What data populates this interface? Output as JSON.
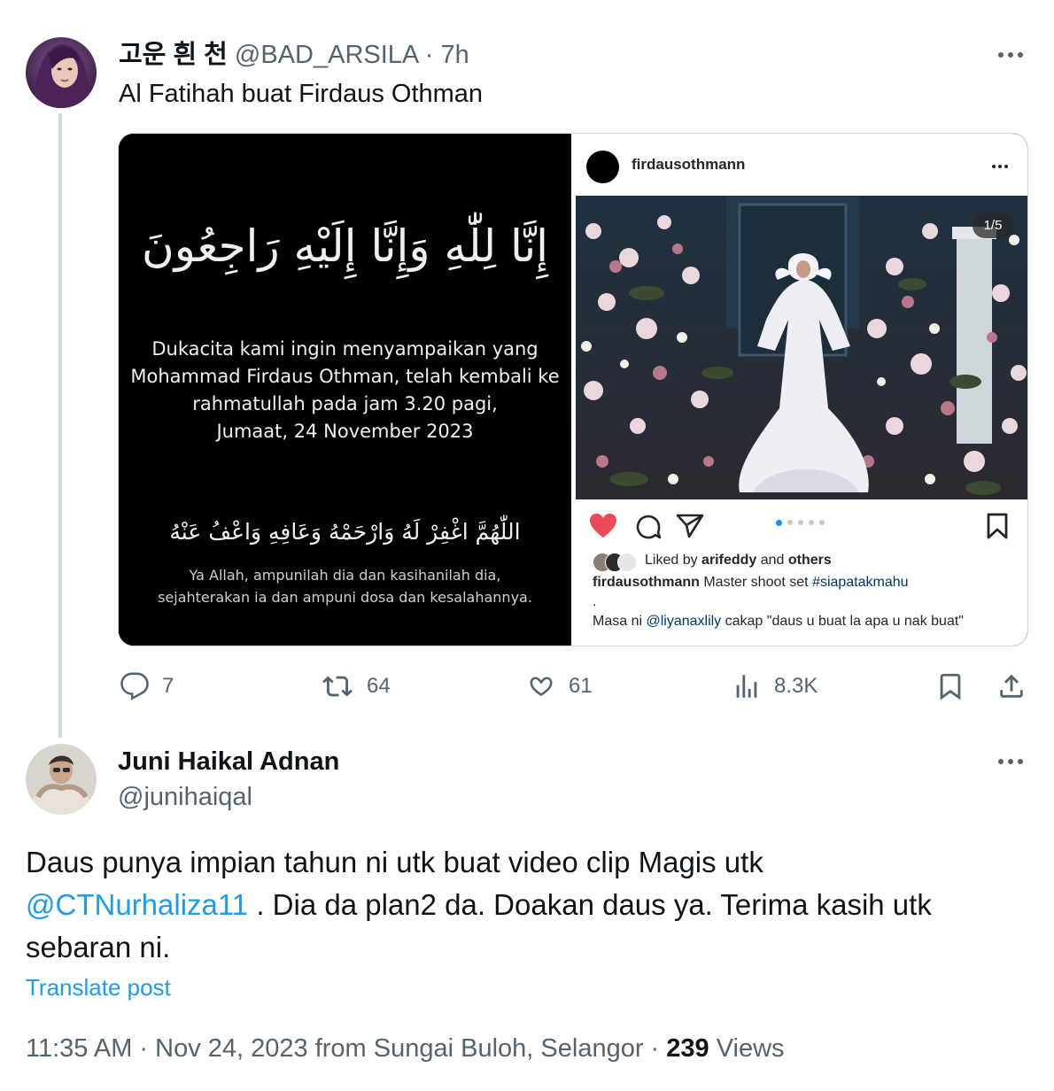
{
  "quoted_post": {
    "display_name": "고운 흰 천",
    "handle": "@BAD_ARSILA",
    "time": "· 7h",
    "text": "Al Fatihah buat Firdaus Othman",
    "condolence": {
      "arabic_title": "إِنَّا لِلّٰهِ وَإِنَّا إِلَيْهِ رَاجِعُونَ",
      "line1": "Dukacita kami ingin menyampaikan yang",
      "line2": "Mohammad Firdaus Othman, telah kembali ke",
      "line3": "rahmatullah pada jam 3.20 pagi,",
      "line4": "Jumaat, 24 November 2023",
      "arabic_prayer": "اللّٰهُمَّ اغْفِرْ لَهُ وَارْحَمْهُ وَعَافِهِ وَاعْفُ عَنْهُ",
      "translation1": "Ya Allah, ampunilah dia dan kasihanilah dia,",
      "translation2": "sejahterakan ia dan ampuni dosa dan kesalahannya."
    },
    "instagram": {
      "username": "firdausothmann",
      "counter": "1/5",
      "liked_prefix": "Liked by ",
      "liked_user": "arifeddy",
      "liked_mid": " and ",
      "liked_others": "others",
      "caption_user": "firdausothmann",
      "caption_text": " Master shoot set ",
      "caption_tag": "#siapatakmahu",
      "dot_line": ".",
      "comment_prefix": "Masa ni ",
      "comment_mention": "@liyanaxlily",
      "comment_text": " cakap \"daus u buat la apa u nak buat\""
    },
    "actions": {
      "replies": "7",
      "reposts": "64",
      "likes": "61",
      "views": "8.3K"
    }
  },
  "main_post": {
    "display_name": "Juni Haikal Adnan",
    "handle": "@junihaiqal",
    "text_part1": "Daus punya impian tahun ni utk buat video clip Magis utk",
    "mention": "@CTNurhaliza11",
    "text_part2": " . Dia da plan2 da. Doakan daus ya. Terima kasih utk",
    "text_part3": "sebaran ni.",
    "translate": "Translate post",
    "timestamp": "11:35 AM · Nov 24, 2023 from Sungai Buloh, Selangor · ",
    "views_count": "239",
    "views_label": " Views"
  },
  "colors": {
    "accent": "#1d9bf0",
    "muted": "#536471",
    "border": "#cfd9de",
    "like_red": "#ed4956"
  }
}
